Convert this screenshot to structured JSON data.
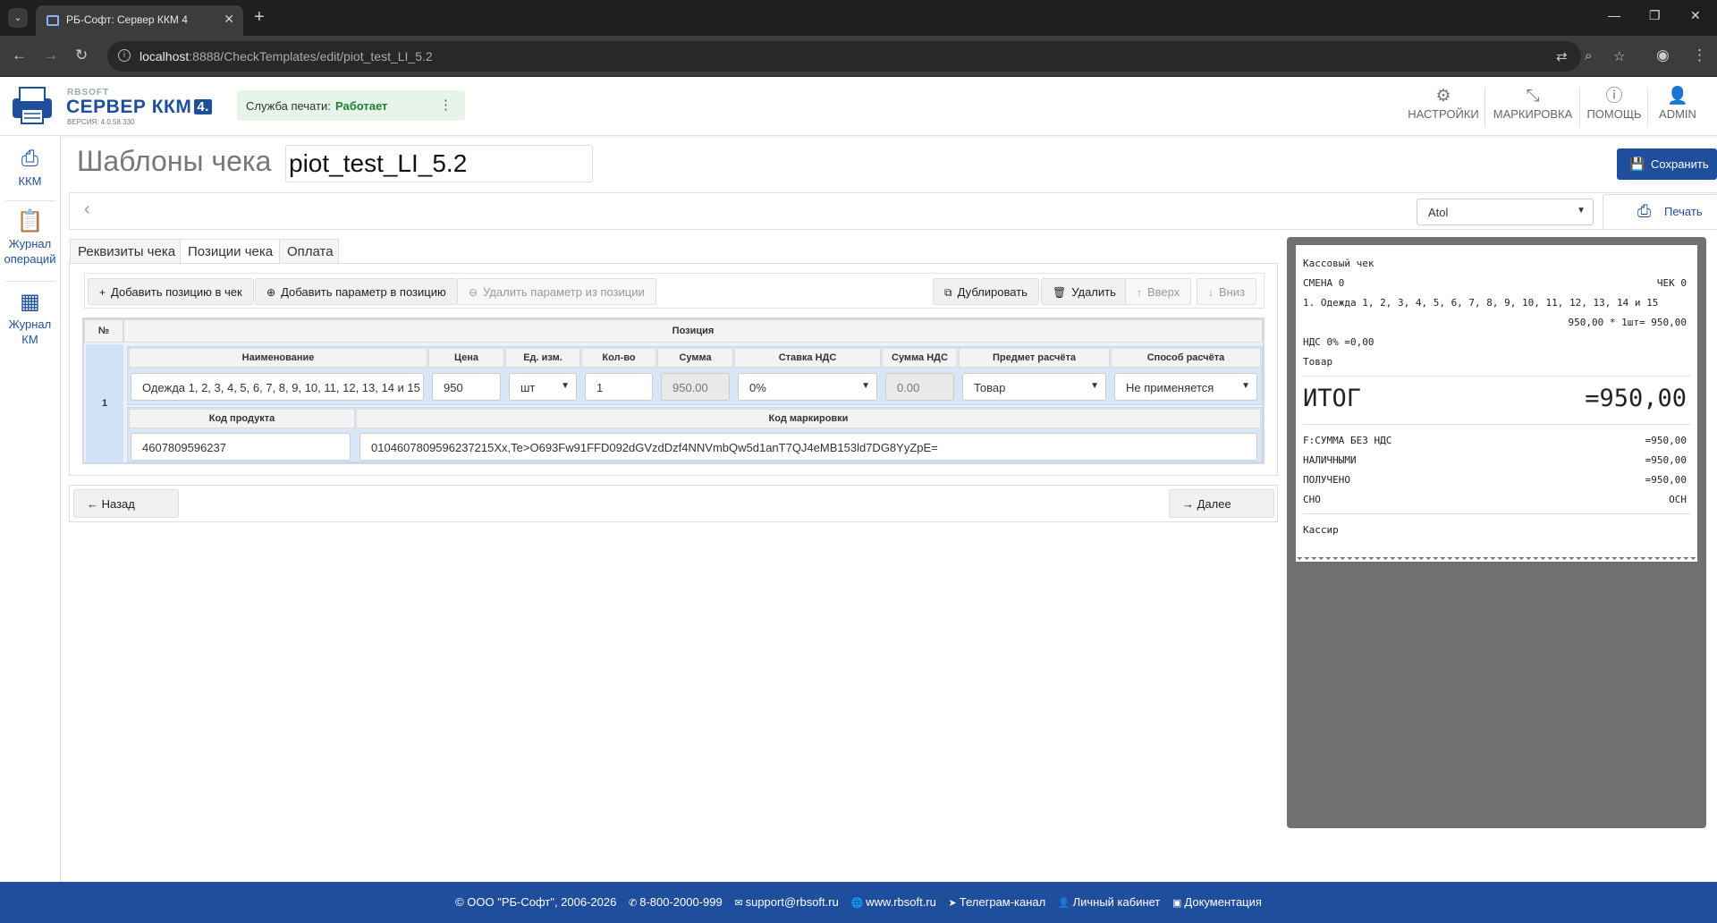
{
  "browser": {
    "tab_title": "РБ-Софт: Сервер ККМ 4",
    "url_host": "localhost",
    "url_rest": ":8888/CheckTemplates/edit/piot_test_LI_5.2"
  },
  "header": {
    "brand": "RBSOFT",
    "product": "СЕРВЕР ККМ",
    "product_badge": "4.",
    "version": "ВЕРСИЯ: 4.0.58.330",
    "print_service_label": "Служба печати:",
    "print_service_status": "Работает",
    "nav": [
      {
        "label": "НАСТРОЙКИ",
        "icon": "gear-icon"
      },
      {
        "label": "МАРКИРОВКА",
        "icon": "marking-icon"
      },
      {
        "label": "ПОМОЩЬ",
        "icon": "help-icon"
      },
      {
        "label": "ADMIN",
        "icon": "user-icon"
      }
    ]
  },
  "sidebar": {
    "items": [
      {
        "label": "ККМ",
        "icon": "printer-icon"
      },
      {
        "label": "Журнал операций",
        "icon": "clipboard-icon"
      },
      {
        "label": "Журнал КМ",
        "icon": "qr-icon"
      }
    ]
  },
  "page": {
    "title": "Шаблоны чека",
    "template_name": "piot_test_LI_5.2",
    "save_label": "Сохранить",
    "kkm_selected": "Atol",
    "print_label": "Печать"
  },
  "tabs": [
    {
      "label": "Реквизиты чека",
      "active": false
    },
    {
      "label": "Позиции чека",
      "active": true
    },
    {
      "label": "Оплата",
      "active": false
    }
  ],
  "toolbar": {
    "add_position": "Добавить позицию в чек",
    "add_param": "Добавить параметр в позицию",
    "remove_param": "Удалить параметр из позиции",
    "duplicate": "Дублировать",
    "delete": "Удалить",
    "up": "Вверх",
    "down": "Вниз"
  },
  "grid": {
    "col_num": "№",
    "col_position": "Позиция",
    "headers": {
      "name": "Наименование",
      "price": "Цена",
      "unit": "Ед. изм.",
      "qty": "Кол-во",
      "sum": "Сумма",
      "vat_rate": "Ставка НДС",
      "vat_sum": "Сумма НДС",
      "subject": "Предмет расчёта",
      "method": "Способ расчёта",
      "product_code": "Код продукта",
      "marking_code": "Код маркировки"
    },
    "row": {
      "num": "1",
      "name": "Одежда 1, 2, 3, 4, 5, 6, 7, 8, 9, 10, 11, 12, 13, 14 и 15",
      "price": "950",
      "unit": "шт",
      "qty": "1",
      "sum": "950.00",
      "vat_rate": "0%",
      "vat_sum": "0.00",
      "subject": "Товар",
      "method": "Не применяется",
      "product_code": "4607809596237",
      "marking_code": "0104607809596237215Xx,Te>O693Fw91FFD092dGVzdDzf4NNVmbQw5d1anT7QJ4eMB153ld7DG8YyZpE="
    }
  },
  "nav_buttons": {
    "back": "Назад",
    "next": "Далее"
  },
  "receipt": {
    "title": "Кассовый чек",
    "shift": "СМЕНА 0",
    "check": "ЧЕК 0",
    "item_line": "1. Одежда 1, 2, 3, 4, 5, 6, 7, 8, 9, 10, 11, 12, 13, 14 и 15",
    "item_calc": "950,00 * 1шт= 950,00",
    "vat_line": "НДС 0% =0,00",
    "item_type": "Товар",
    "total_label": "ИТОГ",
    "total_value": "=950,00",
    "rows": [
      {
        "label": "F:СУММА БЕЗ НДС",
        "value": "=950,00"
      },
      {
        "label": "НАЛИЧНЫМИ",
        "value": "=950,00"
      },
      {
        "label": "ПОЛУЧЕНО",
        "value": "=950,00"
      },
      {
        "label": "СНО",
        "value": "ОСН"
      }
    ],
    "cashier": "Кассир"
  },
  "footer": {
    "copyright": "© ООО \"РБ-Софт\", 2006-2026",
    "phone": "8-800-2000-999",
    "email": "support@rbsoft.ru",
    "site": "www.rbsoft.ru",
    "telegram": "Телеграм-канал",
    "cabinet": "Личный кабинет",
    "docs": "Документация"
  },
  "colors": {
    "brand": "#1f4f9c",
    "status_ok": "#1e7e34"
  }
}
